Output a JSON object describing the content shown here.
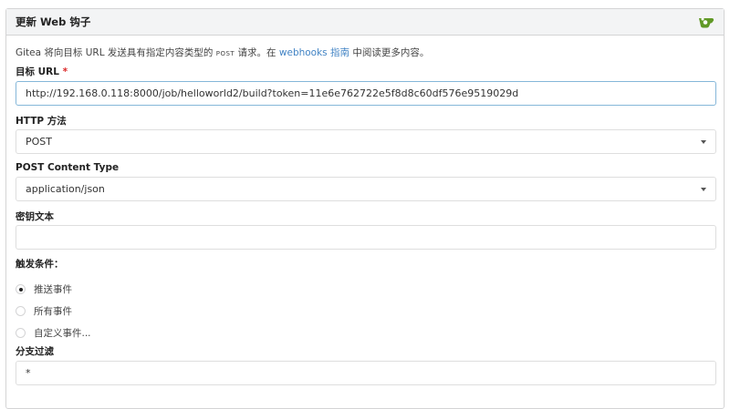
{
  "header": {
    "title": "更新 Web 钩子",
    "logo_icon": "gitea-teacup-icon"
  },
  "description": {
    "pre": "Gitea 将向目标 URL 发送具有指定内容类型的 ",
    "code": "POST",
    "mid": " 请求。在 ",
    "link": "webhooks 指南",
    "post": " 中阅读更多内容。"
  },
  "target_url": {
    "label": "目标 URL",
    "required": "*",
    "value": "http://192.168.0.118:8000/job/helloworld2/build?token=11e6e762722e5f8d8c60df576e9519029d"
  },
  "http_method": {
    "label": "HTTP 方法",
    "value": "POST"
  },
  "content_type": {
    "label": "POST Content Type",
    "value": "application/json"
  },
  "secret": {
    "label": "密钥文本",
    "value": ""
  },
  "trigger": {
    "label": "触发条件：",
    "options": [
      {
        "label": "推送事件",
        "checked": true
      },
      {
        "label": "所有事件",
        "checked": false
      },
      {
        "label": "自定义事件...",
        "checked": false
      }
    ]
  },
  "branch_filter": {
    "label": "分支过滤",
    "value": "*"
  },
  "colors": {
    "accent": "#609926",
    "link": "#4183c4"
  }
}
